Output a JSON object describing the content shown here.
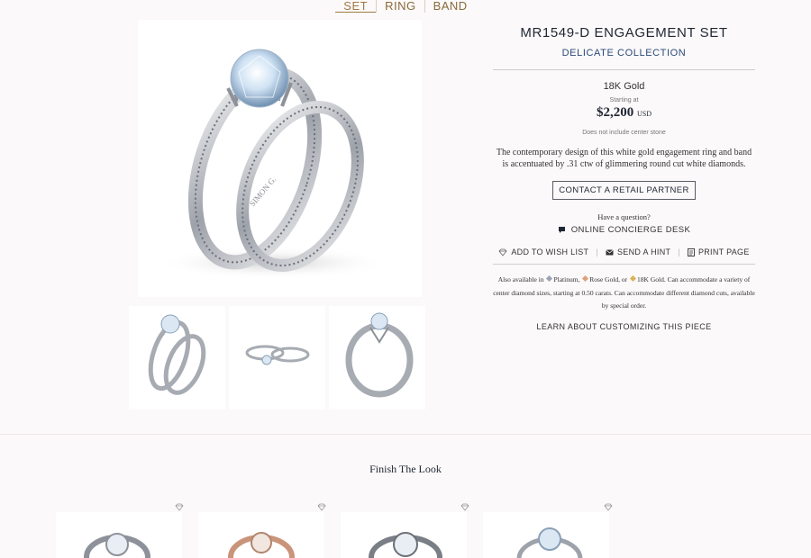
{
  "tabs": [
    {
      "label": "SET",
      "active": true
    },
    {
      "label": "RING",
      "active": false
    },
    {
      "label": "BAND",
      "active": false
    }
  ],
  "product": {
    "title": "MR1549-D ENGAGEMENT SET",
    "collection": "DELICATE COLLECTION",
    "metal": "18K Gold",
    "starting_label": "Starting at",
    "price": "$2,200",
    "currency": "USD",
    "note": "Does not include center stone",
    "description": "The contemporary design of this white gold engagement ring and band is accentuated by .31 ctw of glimmering round cut white diamonds.",
    "engraving": "SIMON G."
  },
  "buttons": {
    "contact": "CONTACT A RETAIL PARTNER",
    "question": "Have a question?",
    "concierge": "ONLINE CONCIERGE DESK",
    "wishlist": "ADD TO WISH LIST",
    "hint": "SEND A HINT",
    "print": "PRINT PAGE",
    "learn": "LEARN ABOUT CUSTOMIZING THIS PIECE"
  },
  "also": {
    "prefix": "Also available in",
    "platinum": "Platinum,",
    "rose": "Rose Gold, or",
    "gold": "18K Gold.",
    "rest": "Can accommodate a variety of center diamond sizes, starting at 0.50 carats. Can accommodate different diamond cuts, available by special order."
  },
  "colors": {
    "platinum": "#9aa3b5",
    "rose": "#e0a07a",
    "gold": "#d9b35a",
    "accent": "#a07a42"
  },
  "finish_title": "Finish The Look",
  "recommendations": [
    {
      "icon": "diamond-outline-icon",
      "metal": "white"
    },
    {
      "icon": "diamond-outline-icon",
      "metal": "rose"
    },
    {
      "icon": "diamond-outline-icon",
      "metal": "white"
    },
    {
      "icon": "diamond-outline-icon",
      "metal": "white"
    }
  ]
}
